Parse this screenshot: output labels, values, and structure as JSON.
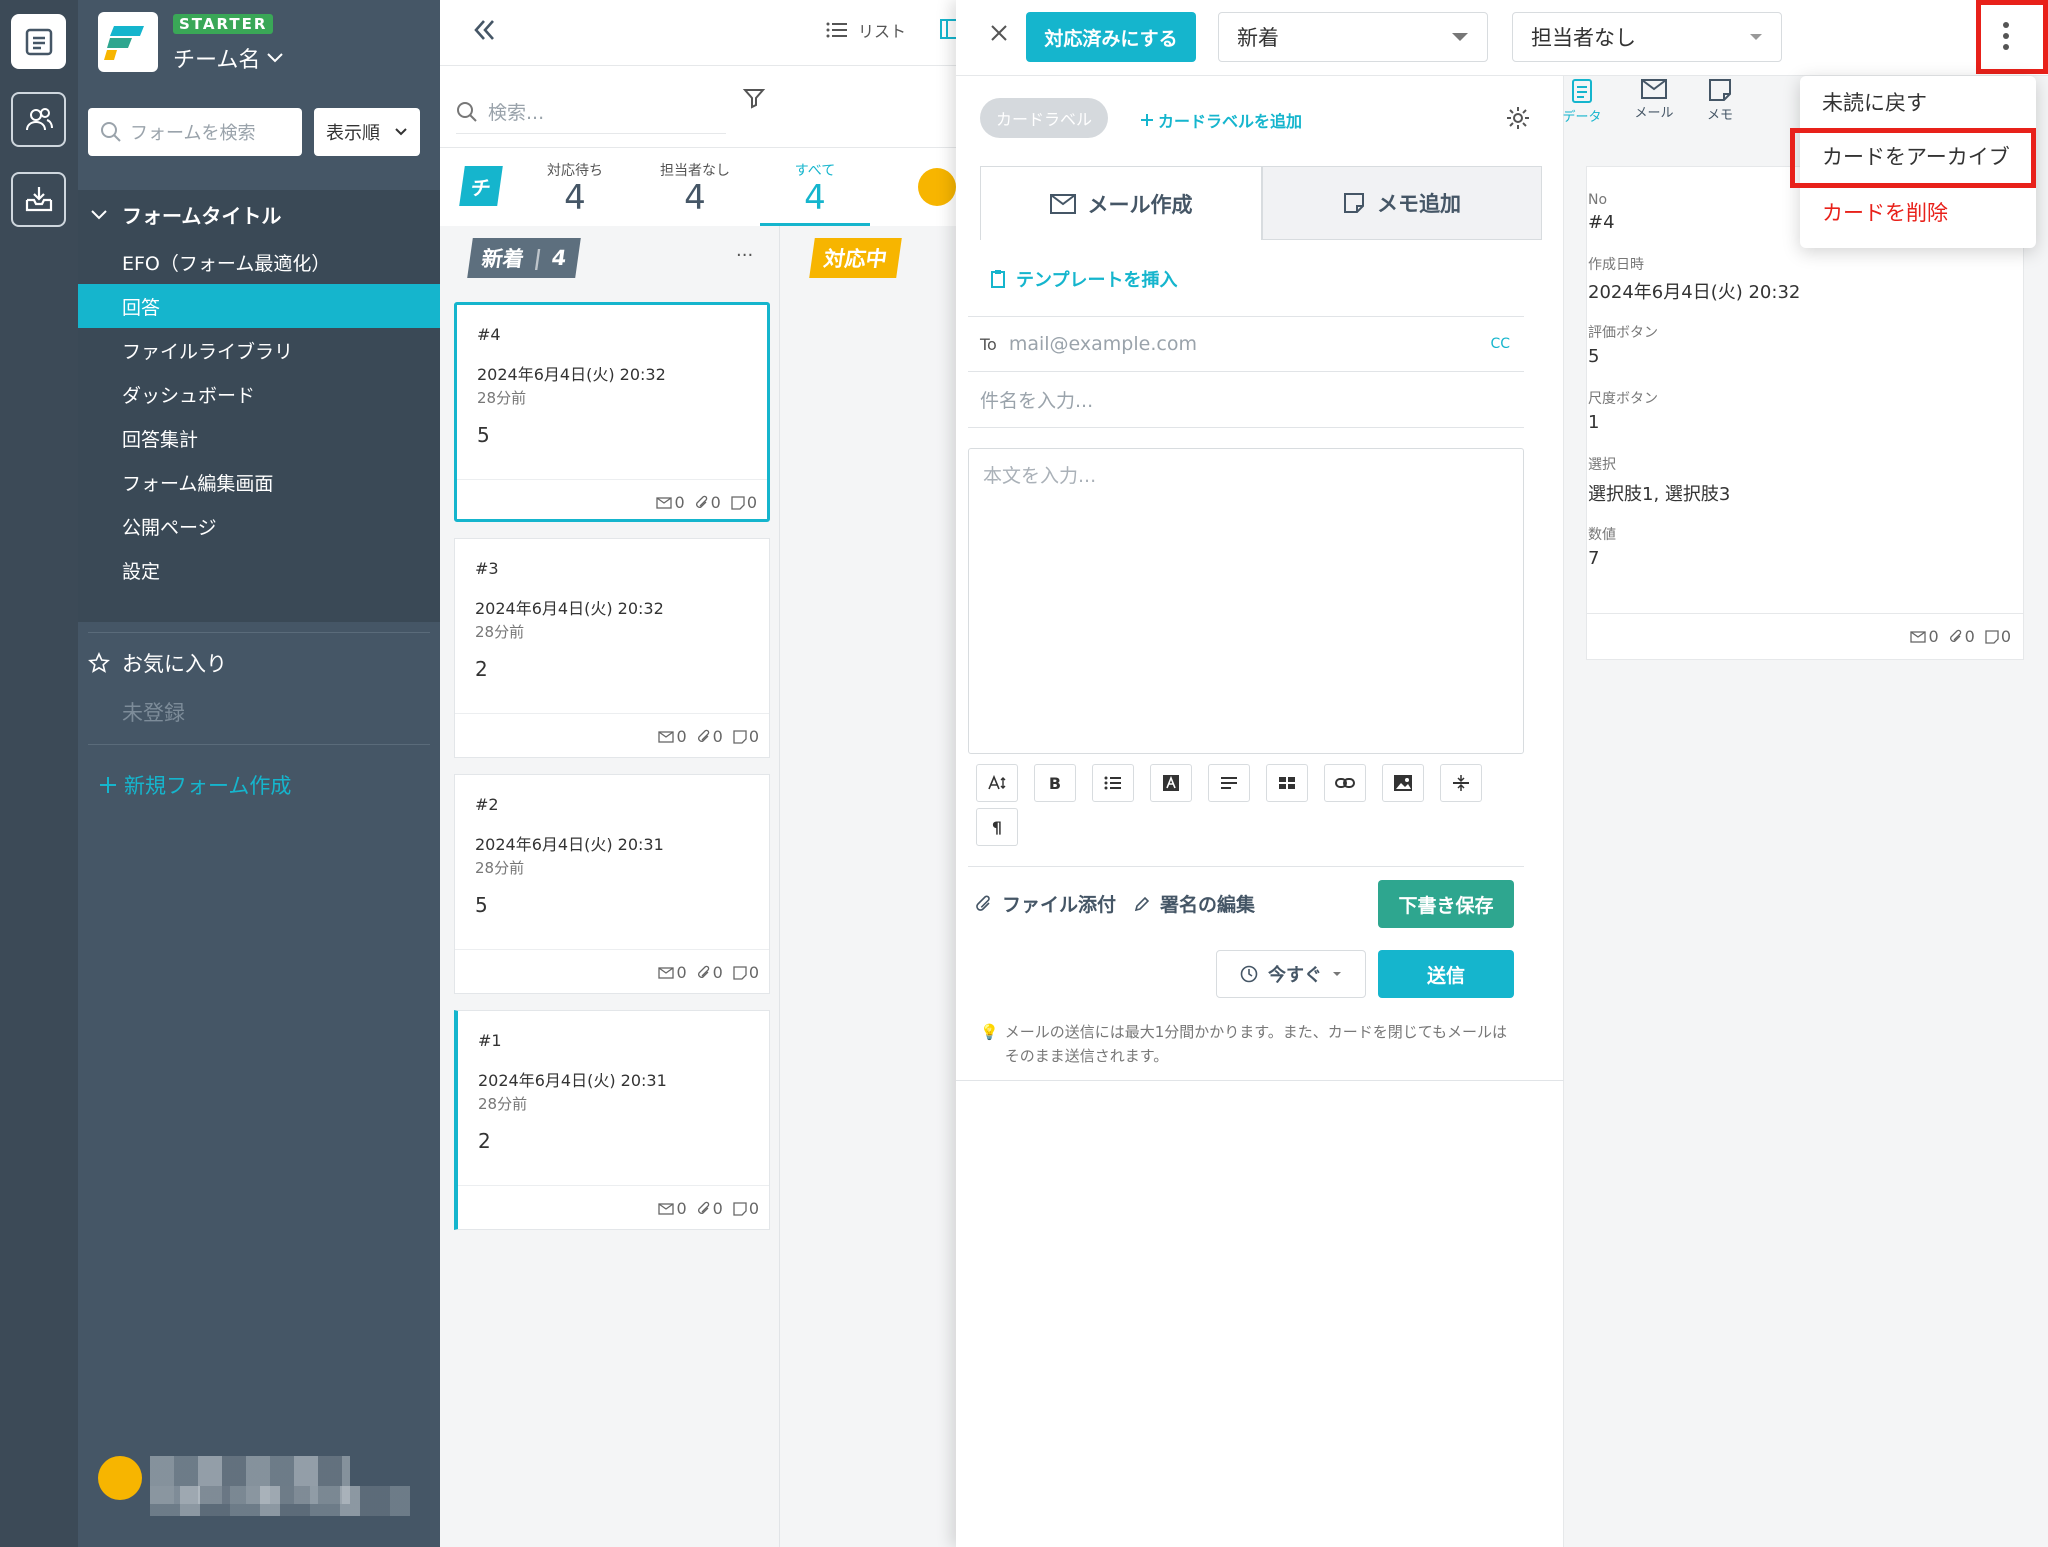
{
  "app": {
    "plan_badge": "STARTER",
    "team_name": "チーム名",
    "form_search_placeholder": "フォームを検索",
    "sort_label": "表示順"
  },
  "sidebar": {
    "form_title": "フォームタイトル",
    "items": [
      {
        "label": "EFO（フォーム最適化）"
      },
      {
        "label": "回答",
        "active": true
      },
      {
        "label": "ファイルライブラリ"
      },
      {
        "label": "ダッシュボード"
      },
      {
        "label": "回答集計"
      },
      {
        "label": "フォーム編集画面"
      },
      {
        "label": "公開ページ"
      },
      {
        "label": "設定"
      }
    ],
    "favorites_label": "お気に入り",
    "favorites_empty": "未登録",
    "new_form_label": "新規フォーム作成"
  },
  "list": {
    "view_list_label": "リスト",
    "search_placeholder": "検索...",
    "team_chip": "チ",
    "tabs": [
      {
        "label": "対応待ち",
        "count": "4"
      },
      {
        "label": "担当者なし",
        "count": "4"
      },
      {
        "label": "すべて",
        "count": "4",
        "active": true
      }
    ],
    "column_new": {
      "label": "新着",
      "count": "4",
      "more": "..."
    },
    "column_wip": {
      "label": "対応中"
    },
    "cards": [
      {
        "no": "#4",
        "datetime": "2024年6月4日(火) 20:32",
        "ago": "28分前",
        "value": "5",
        "mail": "0",
        "attach": "0",
        "memo": "0"
      },
      {
        "no": "#3",
        "datetime": "2024年6月4日(火) 20:32",
        "ago": "28分前",
        "value": "2",
        "mail": "0",
        "attach": "0",
        "memo": "0"
      },
      {
        "no": "#2",
        "datetime": "2024年6月4日(火) 20:31",
        "ago": "28分前",
        "value": "5",
        "mail": "0",
        "attach": "0",
        "memo": "0"
      },
      {
        "no": "#1",
        "datetime": "2024年6月4日(火) 20:31",
        "ago": "28分前",
        "value": "2",
        "mail": "0",
        "attach": "0",
        "memo": "0"
      }
    ]
  },
  "detail": {
    "done_button": "対応済みにする",
    "status_select": "新着",
    "assignee_select": "担当者なし",
    "card_label_chip": "カードラベル",
    "add_card_label": "カードラベルを追加",
    "tab_mail": "メール作成",
    "tab_memo": "メモ追加",
    "insert_template": "テンプレートを挿入",
    "to_label": "To",
    "to_placeholder": "mail@example.com",
    "cc_label": "CC",
    "subject_placeholder": "件名を入力...",
    "body_placeholder": "本文を入力...",
    "toolbar": {
      "bold": "B",
      "paragraph": "¶"
    },
    "attach_file": "ファイル添付",
    "edit_signature": "署名の編集",
    "save_draft": "下書き保存",
    "schedule": "今すぐ",
    "send": "送信",
    "notice": "メールの送信には最大1分間かかります。また、カードを閉じてもメールはそのまま送信されます。"
  },
  "side_tabs": [
    {
      "label": "データ",
      "active": true
    },
    {
      "label": "メール"
    },
    {
      "label": "メモ"
    }
  ],
  "data_panel": {
    "fields": [
      {
        "label": "No",
        "value": "#4"
      },
      {
        "label": "作成日時",
        "value": "2024年6月4日(火) 20:32"
      },
      {
        "label": "評価ボタン",
        "value": "5"
      },
      {
        "label": "尺度ボタン",
        "value": "1"
      },
      {
        "label": "選択",
        "value": "選択肢1, 選択肢3"
      },
      {
        "label": "数値",
        "value": "7"
      }
    ],
    "mail": "0",
    "attach": "0",
    "memo": "0"
  },
  "menu": {
    "items": [
      {
        "label": "未読に戻す"
      },
      {
        "label": "カードをアーカイブ"
      },
      {
        "label": "カードを削除"
      }
    ]
  },
  "colors": {
    "accent": "#15b5cd",
    "sidebar": "#455666",
    "danger": "#e8211a",
    "green": "#2ea68f"
  }
}
